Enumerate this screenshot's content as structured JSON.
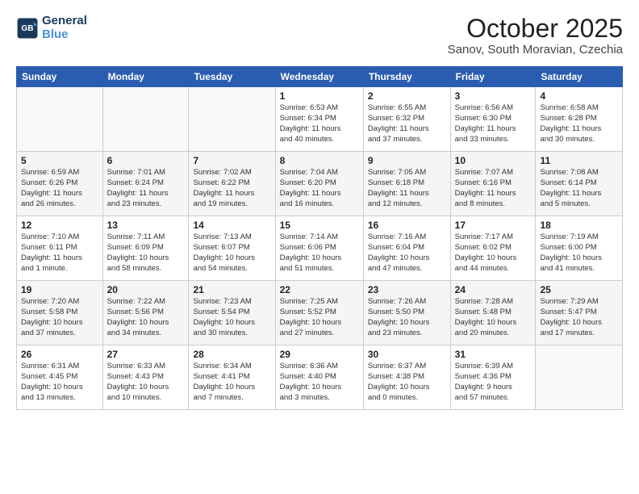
{
  "header": {
    "logo_line1": "General",
    "logo_line2": "Blue",
    "month": "October 2025",
    "location": "Sanov, South Moravian, Czechia"
  },
  "weekdays": [
    "Sunday",
    "Monday",
    "Tuesday",
    "Wednesday",
    "Thursday",
    "Friday",
    "Saturday"
  ],
  "weeks": [
    [
      {
        "day": "",
        "info": ""
      },
      {
        "day": "",
        "info": ""
      },
      {
        "day": "",
        "info": ""
      },
      {
        "day": "1",
        "info": "Sunrise: 6:53 AM\nSunset: 6:34 PM\nDaylight: 11 hours\nand 40 minutes."
      },
      {
        "day": "2",
        "info": "Sunrise: 6:55 AM\nSunset: 6:32 PM\nDaylight: 11 hours\nand 37 minutes."
      },
      {
        "day": "3",
        "info": "Sunrise: 6:56 AM\nSunset: 6:30 PM\nDaylight: 11 hours\nand 33 minutes."
      },
      {
        "day": "4",
        "info": "Sunrise: 6:58 AM\nSunset: 6:28 PM\nDaylight: 11 hours\nand 30 minutes."
      }
    ],
    [
      {
        "day": "5",
        "info": "Sunrise: 6:59 AM\nSunset: 6:26 PM\nDaylight: 11 hours\nand 26 minutes."
      },
      {
        "day": "6",
        "info": "Sunrise: 7:01 AM\nSunset: 6:24 PM\nDaylight: 11 hours\nand 23 minutes."
      },
      {
        "day": "7",
        "info": "Sunrise: 7:02 AM\nSunset: 6:22 PM\nDaylight: 11 hours\nand 19 minutes."
      },
      {
        "day": "8",
        "info": "Sunrise: 7:04 AM\nSunset: 6:20 PM\nDaylight: 11 hours\nand 16 minutes."
      },
      {
        "day": "9",
        "info": "Sunrise: 7:05 AM\nSunset: 6:18 PM\nDaylight: 11 hours\nand 12 minutes."
      },
      {
        "day": "10",
        "info": "Sunrise: 7:07 AM\nSunset: 6:16 PM\nDaylight: 11 hours\nand 8 minutes."
      },
      {
        "day": "11",
        "info": "Sunrise: 7:08 AM\nSunset: 6:14 PM\nDaylight: 11 hours\nand 5 minutes."
      }
    ],
    [
      {
        "day": "12",
        "info": "Sunrise: 7:10 AM\nSunset: 6:11 PM\nDaylight: 11 hours\nand 1 minute."
      },
      {
        "day": "13",
        "info": "Sunrise: 7:11 AM\nSunset: 6:09 PM\nDaylight: 10 hours\nand 58 minutes."
      },
      {
        "day": "14",
        "info": "Sunrise: 7:13 AM\nSunset: 6:07 PM\nDaylight: 10 hours\nand 54 minutes."
      },
      {
        "day": "15",
        "info": "Sunrise: 7:14 AM\nSunset: 6:06 PM\nDaylight: 10 hours\nand 51 minutes."
      },
      {
        "day": "16",
        "info": "Sunrise: 7:16 AM\nSunset: 6:04 PM\nDaylight: 10 hours\nand 47 minutes."
      },
      {
        "day": "17",
        "info": "Sunrise: 7:17 AM\nSunset: 6:02 PM\nDaylight: 10 hours\nand 44 minutes."
      },
      {
        "day": "18",
        "info": "Sunrise: 7:19 AM\nSunset: 6:00 PM\nDaylight: 10 hours\nand 41 minutes."
      }
    ],
    [
      {
        "day": "19",
        "info": "Sunrise: 7:20 AM\nSunset: 5:58 PM\nDaylight: 10 hours\nand 37 minutes."
      },
      {
        "day": "20",
        "info": "Sunrise: 7:22 AM\nSunset: 5:56 PM\nDaylight: 10 hours\nand 34 minutes."
      },
      {
        "day": "21",
        "info": "Sunrise: 7:23 AM\nSunset: 5:54 PM\nDaylight: 10 hours\nand 30 minutes."
      },
      {
        "day": "22",
        "info": "Sunrise: 7:25 AM\nSunset: 5:52 PM\nDaylight: 10 hours\nand 27 minutes."
      },
      {
        "day": "23",
        "info": "Sunrise: 7:26 AM\nSunset: 5:50 PM\nDaylight: 10 hours\nand 23 minutes."
      },
      {
        "day": "24",
        "info": "Sunrise: 7:28 AM\nSunset: 5:48 PM\nDaylight: 10 hours\nand 20 minutes."
      },
      {
        "day": "25",
        "info": "Sunrise: 7:29 AM\nSunset: 5:47 PM\nDaylight: 10 hours\nand 17 minutes."
      }
    ],
    [
      {
        "day": "26",
        "info": "Sunrise: 6:31 AM\nSunset: 4:45 PM\nDaylight: 10 hours\nand 13 minutes."
      },
      {
        "day": "27",
        "info": "Sunrise: 6:33 AM\nSunset: 4:43 PM\nDaylight: 10 hours\nand 10 minutes."
      },
      {
        "day": "28",
        "info": "Sunrise: 6:34 AM\nSunset: 4:41 PM\nDaylight: 10 hours\nand 7 minutes."
      },
      {
        "day": "29",
        "info": "Sunrise: 6:36 AM\nSunset: 4:40 PM\nDaylight: 10 hours\nand 3 minutes."
      },
      {
        "day": "30",
        "info": "Sunrise: 6:37 AM\nSunset: 4:38 PM\nDaylight: 10 hours\nand 0 minutes."
      },
      {
        "day": "31",
        "info": "Sunrise: 6:39 AM\nSunset: 4:36 PM\nDaylight: 9 hours\nand 57 minutes."
      },
      {
        "day": "",
        "info": ""
      }
    ]
  ]
}
